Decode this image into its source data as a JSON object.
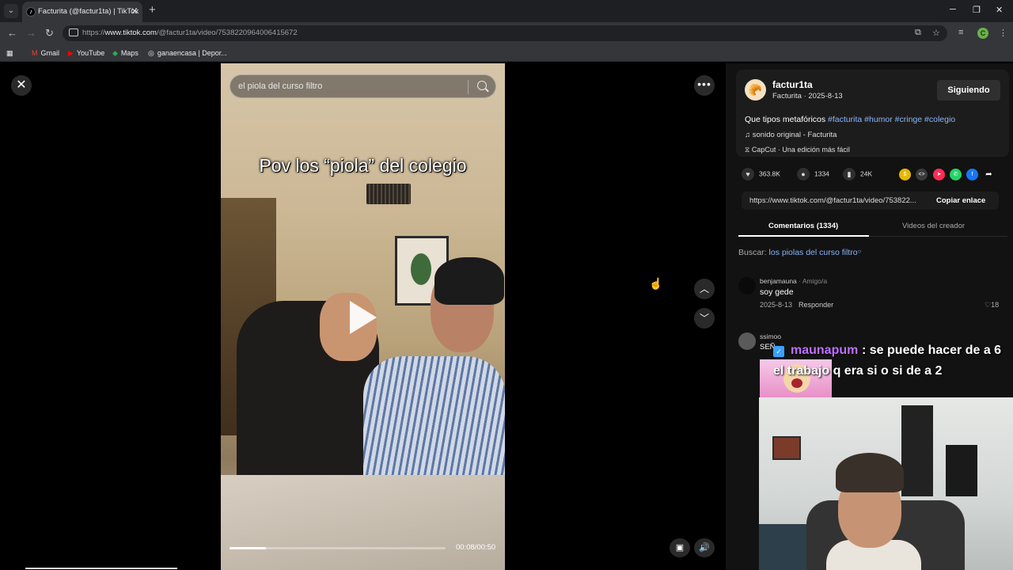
{
  "browser": {
    "tab_title": "Facturita (@factur1ta) | TikTok",
    "url_prefix": "https://",
    "url_host": "www.tiktok.com",
    "url_path": "/@factur1ta/video/7538220964006415672",
    "bookmarks": [
      {
        "label": "Gmail",
        "icon": "gmail-icon"
      },
      {
        "label": "YouTube",
        "icon": "youtube-icon"
      },
      {
        "label": "Maps",
        "icon": "maps-icon"
      },
      {
        "label": "ganaencasa | Depor...",
        "icon": "globe-icon"
      }
    ],
    "profile_initial": "C"
  },
  "video": {
    "search_query": "el piola del curso filtro",
    "caption": "Pov los “piola” del colegio",
    "time": "00:08/00:50",
    "progress": 0.17
  },
  "post": {
    "username": "factur1ta",
    "display_name": "Facturita",
    "date": "2025-8-13",
    "subline": "Facturita · 2025-8-13",
    "follow_label": "Siguiendo",
    "description": "Que tipos metafóricos ",
    "hashtags": "#facturita #humor #cringe #colegio",
    "music": "sonido original - Facturita",
    "capcut": "CapCut · Una edición más fácil",
    "likes": "363.8K",
    "comments": "1334",
    "saves": "24K",
    "share_link": "https://www.tiktok.com/@factur1ta/video/753822...",
    "copy_label": "Copiar enlace"
  },
  "comments_panel": {
    "tab_comments": "Comentarios (1334)",
    "tab_videos": "Videos del creador",
    "search_label": "Buscar: ",
    "search_term": "los piolas del curso filtro",
    "items": [
      {
        "user": "benjamauna",
        "friend": " · Amigo/a",
        "text": "soy gede",
        "date": "2025-8-13",
        "reply": "Responder",
        "likes": "18"
      },
      {
        "user": "ssimoo",
        "friend": "",
        "text": "SEÑ",
        "date": "",
        "reply": "",
        "likes": ""
      }
    ]
  },
  "stream_chat": {
    "user": "maunapum",
    "line1": ": se puede hacer de a 6",
    "line2": "el trabajo q era si o si de a 2"
  },
  "colors": {
    "background": "#000000",
    "panel": "#121212",
    "link": "#8ab4f8",
    "chat_user": "#c070ff"
  }
}
